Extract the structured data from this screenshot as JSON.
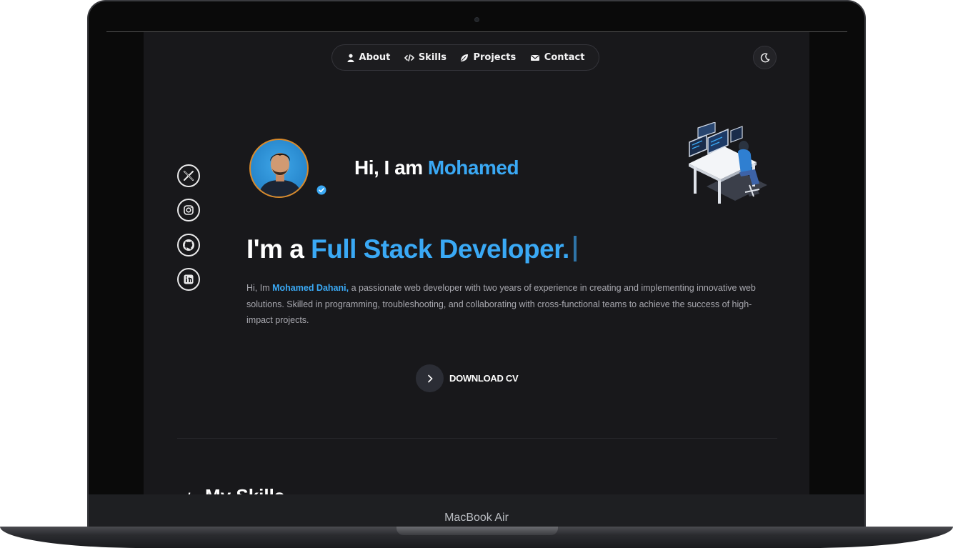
{
  "device": {
    "label": "MacBook Air"
  },
  "nav": {
    "items": [
      {
        "label": "About",
        "icon": "user-icon"
      },
      {
        "label": "Skills",
        "icon": "code-icon"
      },
      {
        "label": "Projects",
        "icon": "leaf-icon"
      },
      {
        "label": "Contact",
        "icon": "envelope-icon"
      }
    ],
    "theme_icon": "moon-icon"
  },
  "social": [
    "x-twitter-icon",
    "instagram-icon",
    "github-icon",
    "linkedin-icon"
  ],
  "hero": {
    "greeting_prefix": "Hi, I am",
    "greeting_name": "Mohamed",
    "headline_prefix": "I'm a",
    "headline_role": "Full Stack Developer.",
    "bio_prefix": "Hi, Im",
    "bio_name": "Mohamed Dahani,",
    "bio_text": " a passionate web developer with two years of experience in creating and implementing innovative web solutions. Skilled in programming, troubleshooting, and collaborating with cross-functional teams to achieve the success of high-impact projects.",
    "cv_label": "DOWNLOAD CV"
  },
  "next_section": {
    "title": "My Skills"
  },
  "colors": {
    "accent": "#3aa9f5",
    "background": "#18181b",
    "avatar_ring": "#d98a2b"
  }
}
